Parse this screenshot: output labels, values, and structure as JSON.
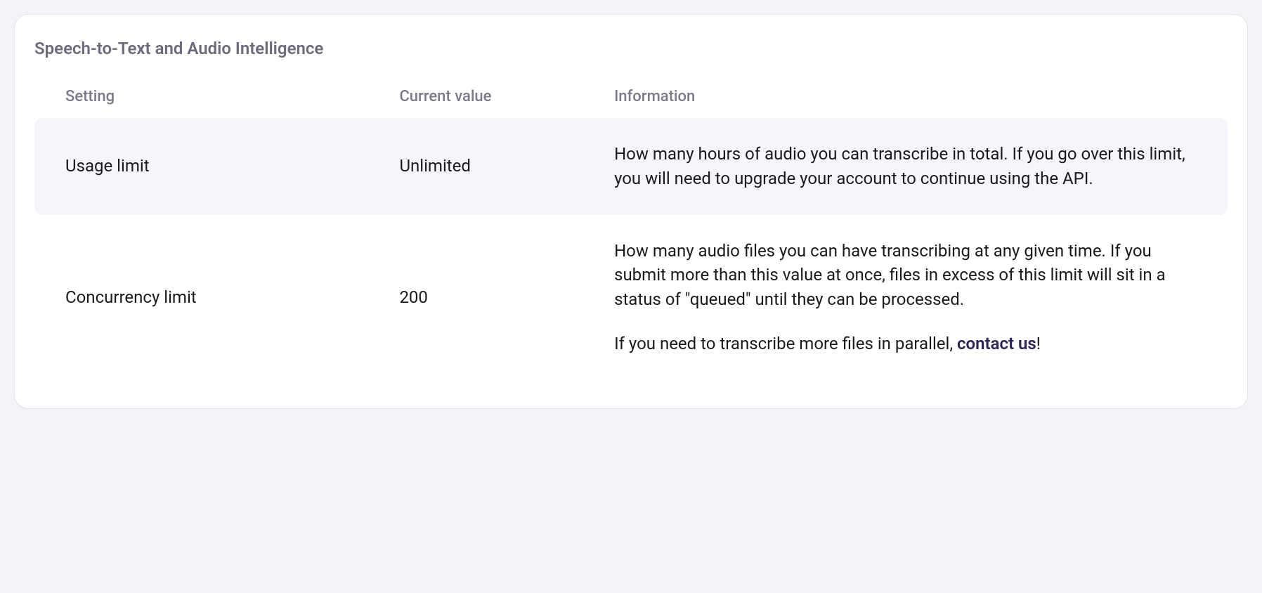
{
  "card": {
    "title": "Speech-to-Text and Audio Intelligence",
    "columns": {
      "setting": "Setting",
      "value": "Current value",
      "info": "Information"
    },
    "rows": [
      {
        "setting": "Usage limit",
        "value": "Unlimited",
        "info": "How many hours of audio you can transcribe in total. If you go over this limit, you will need to upgrade your account to continue using the API."
      },
      {
        "setting": "Concurrency limit",
        "value": "200",
        "info_p1": "How many audio files you can have transcribing at any given time. If you submit more than this value at once, files in excess of this limit will sit in a status of \"queued\" until they can be processed.",
        "info_p2_prefix": "If you need to transcribe more files in parallel, ",
        "info_p2_link": "contact us",
        "info_p2_suffix": "!"
      }
    ]
  }
}
